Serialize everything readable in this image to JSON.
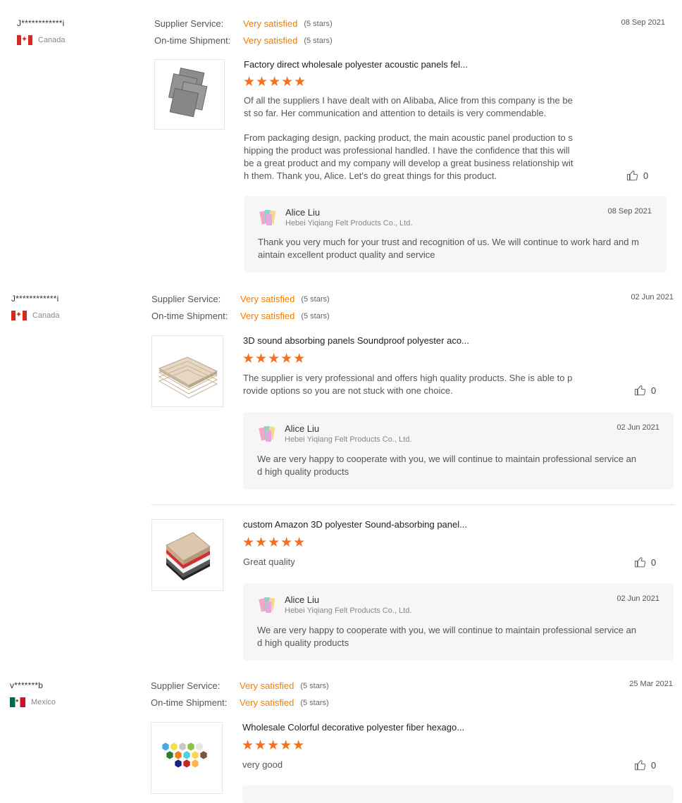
{
  "reviews": [
    {
      "user": "J************i",
      "country": "Canada",
      "supplier_service_label": "Supplier Service:",
      "supplier_service_value": "Very satisfied",
      "supplier_service_stars": "(5 stars)",
      "shipment_label": "On-time Shipment:",
      "shipment_value": "Very satisfied",
      "shipment_stars": "(5 stars)",
      "date": "08 Sep 2021",
      "product_title": "Factory direct wholesale polyester acoustic panels fel...",
      "rating": 5,
      "text": "Of all the suppliers I have dealt with on Alibaba, Alice from this company is the be\nst so far. Her communication and attention to details is very commendable.\n\nFrom packaging design, packing product, the main acoustic panel production to s\nhipping the product was professional handled. I have the confidence that this will\nbe a great product and my company will develop a great business relationship wit\nh them. Thank you, Alice. Let's do great things for this product.",
      "likes": "0",
      "reply": {
        "name": "Alice Liu",
        "company": "Hebei Yiqiang Felt Products Co., Ltd.",
        "date": "08 Sep 2021",
        "text": "Thank you very much for your trust and recognition of us. We will continue to work hard and m\naintain excellent product quality and service"
      }
    },
    {
      "user": "J************i",
      "country": "Canada",
      "supplier_service_label": "Supplier Service:",
      "supplier_service_value": "Very satisfied",
      "supplier_service_stars": "(5 stars)",
      "shipment_label": "On-time Shipment:",
      "shipment_value": "Very satisfied",
      "shipment_stars": "(5 stars)",
      "date": "02 Jun 2021",
      "product_title": "3D sound absorbing panels Soundproof polyester aco...",
      "rating": 5,
      "text": "The supplier is very professional and offers high quality products. She is able to p\nrovide options so you are not stuck with one choice.",
      "likes": "0",
      "reply": {
        "name": "Alice Liu",
        "company": "Hebei Yiqiang Felt Products Co., Ltd.",
        "date": "02 Jun 2021",
        "text": "We are very happy to cooperate with you, we will continue to maintain professional service an\nd high quality products"
      }
    },
    {
      "product_title": "custom Amazon 3D polyester Sound-absorbing panel...",
      "rating": 5,
      "text": "Great quality",
      "likes": "0",
      "reply": {
        "name": "Alice Liu",
        "company": "Hebei Yiqiang Felt Products Co., Ltd.",
        "date": "02 Jun 2021",
        "text": "We are very happy to cooperate with you, we will continue to maintain professional service an\nd high quality products"
      }
    },
    {
      "user": "v*******b",
      "country": "Mexico",
      "supplier_service_label": "Supplier Service:",
      "supplier_service_value": "Very satisfied",
      "supplier_service_stars": "(5 stars)",
      "shipment_label": "On-time Shipment:",
      "shipment_value": "Very satisfied",
      "shipment_stars": "(5 stars)",
      "date": "25 Mar 2021",
      "product_title": "Wholesale Colorful decorative polyester fiber hexago...",
      "rating": 5,
      "text": "very good",
      "likes": "0"
    }
  ],
  "star_glyph": "★★★★★",
  "colors": {
    "accent_orange": "#f57c00",
    "star_orange": "#f37021",
    "reply_bg": "#f6f6f6"
  },
  "icons": {
    "like": "thumbs-up-icon",
    "avatar": "supplier-avatar-icon"
  }
}
